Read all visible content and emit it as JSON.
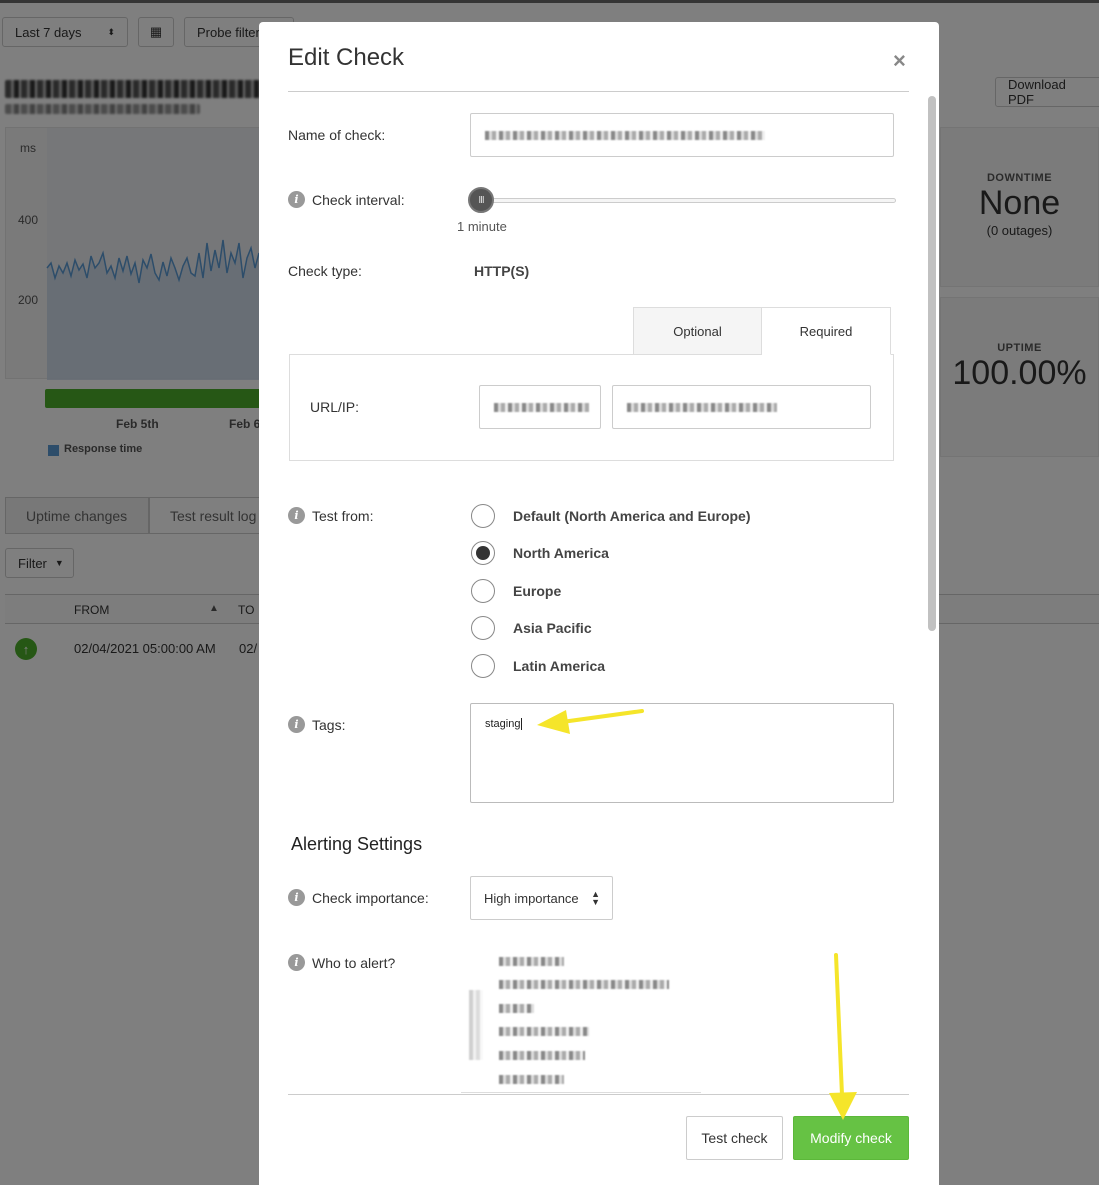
{
  "background": {
    "date_range": "Last 7 days",
    "probe_filter": "Probe filter",
    "download_pdf": "Download PDF",
    "chart": {
      "unit": "ms",
      "y_ticks": [
        "400",
        "200"
      ],
      "x_ticks": [
        "Feb 5th",
        "Feb 6"
      ],
      "legend": "Response time"
    },
    "downtime": {
      "title": "DOWNTIME",
      "value": "None",
      "sub": "(0 outages)"
    },
    "uptime": {
      "title": "UPTIME",
      "value": "100.00%"
    },
    "tabs": [
      "Uptime changes",
      "Test result log"
    ],
    "filter": "Filter",
    "table": {
      "columns": [
        "FROM",
        "TO"
      ],
      "rows": [
        {
          "from": "02/04/2021 05:00:00 AM",
          "to": "02/"
        }
      ]
    }
  },
  "modal": {
    "title": "Edit Check",
    "close": "×",
    "name_label": "Name of check:",
    "interval_label": "Check interval:",
    "interval_value": "1 minute",
    "slider_grip": "III",
    "check_type_label": "Check type:",
    "check_type_value": "HTTP(S)",
    "tabs": {
      "optional": "Optional",
      "required": "Required"
    },
    "url_label": "URL/IP:",
    "test_from_label": "Test from:",
    "regions": [
      {
        "label": "Default (North America and Europe)",
        "checked": false
      },
      {
        "label": "North America",
        "checked": true
      },
      {
        "label": "Europe",
        "checked": false
      },
      {
        "label": "Asia Pacific",
        "checked": false
      },
      {
        "label": "Latin America",
        "checked": false
      }
    ],
    "tags_label": "Tags:",
    "tags_value": "staging",
    "alerting_title": "Alerting Settings",
    "importance_label": "Check importance:",
    "importance_value": "High importance",
    "who_label": "Who to alert?",
    "test_button": "Test check",
    "modify_button": "Modify check",
    "info_glyph": "i"
  },
  "colors": {
    "primary_button": "#66c244",
    "annotation_arrow": "#f5e52a",
    "uptime_bar": "#4caf2a"
  }
}
